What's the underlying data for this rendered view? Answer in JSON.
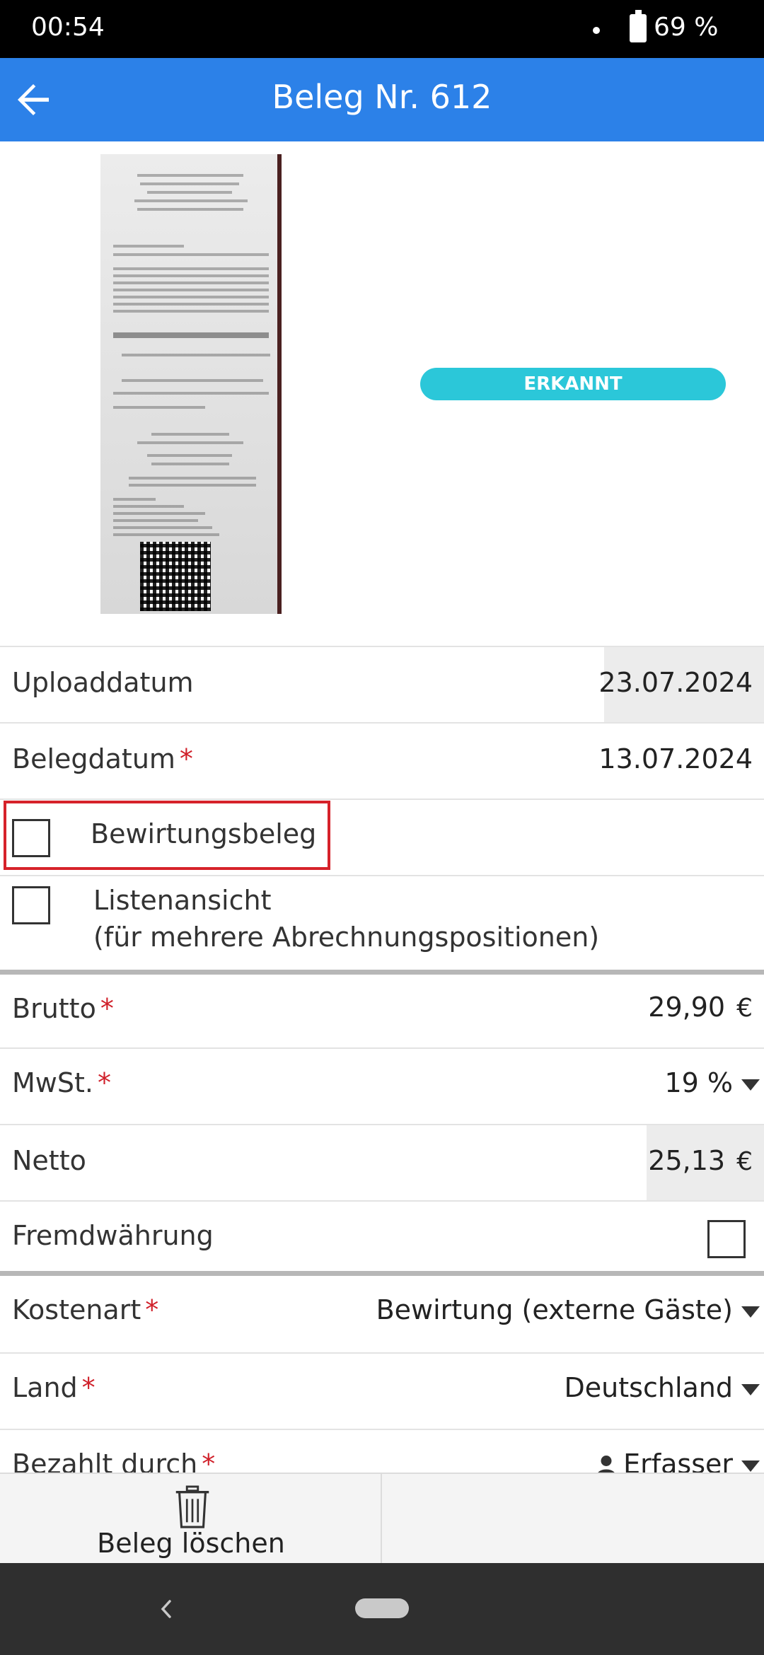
{
  "status_bar": {
    "time": "00:54",
    "battery": "69 %"
  },
  "app_bar": {
    "title": "Beleg Nr. 612",
    "back_icon": "arrow-left-icon"
  },
  "receipt": {
    "status_badge": "ERKANNT"
  },
  "fields": {
    "upload_date": {
      "label": "Uploaddatum",
      "value": "23.07.2024"
    },
    "receipt_date": {
      "label": "Belegdatum",
      "value": "13.07.2024",
      "required": "*"
    },
    "hospitality": {
      "label": "Bewirtungsbeleg",
      "checked": false
    },
    "list_view": {
      "label_line1": "Listenansicht",
      "label_line2": "(für mehrere Abrechnungspositionen)",
      "checked": false
    },
    "gross": {
      "label": "Brutto",
      "value": "29,90",
      "currency": "€",
      "required": "*"
    },
    "vat": {
      "label": "MwSt.",
      "value": "19 %",
      "required": "*"
    },
    "net": {
      "label": "Netto",
      "value": "25,13",
      "currency": "€"
    },
    "foreign_currency": {
      "label": "Fremdwährung",
      "checked": false
    },
    "cost_type": {
      "label": "Kostenart",
      "value": "Bewirtung (externe Gäste)",
      "required": "*"
    },
    "country": {
      "label": "Land",
      "value": "Deutschland",
      "required": "*"
    },
    "paid_by": {
      "label": "Bezahlt durch",
      "value": "Erfasser",
      "required": "*"
    }
  },
  "bottom_bar": {
    "delete_label": "Beleg löschen",
    "delete_icon": "trash-icon"
  },
  "colors": {
    "app_bar": "#2c81e8",
    "badge": "#2bc7d9",
    "required": "#d0202a",
    "highlight": "#d6222a"
  }
}
